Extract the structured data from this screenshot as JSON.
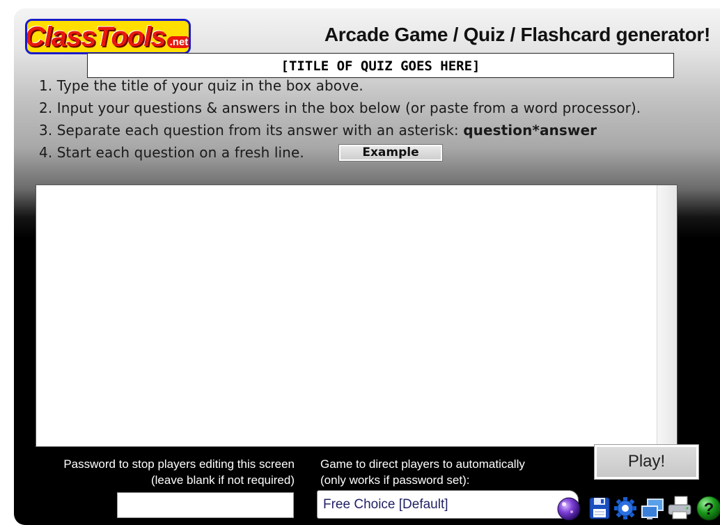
{
  "header": {
    "logo_text": "ClassTools",
    "logo_suffix": ".net",
    "title": "Arcade Game / Quiz / Flashcard generator!"
  },
  "quiz_title": {
    "value": "[TITLE OF QUIZ GOES HERE]"
  },
  "instructions": {
    "step1": "1. Type the title of your quiz in the box above.",
    "step2": "2. Input your questions & answers in the box below (or paste from a word processor).",
    "step3_text": "3. Separate each question from its answer with an asterisk: ",
    "step3_bold": "question*answer",
    "step4": "4. Start each question on a fresh line.",
    "example_button": "Example"
  },
  "editor": {
    "content": ""
  },
  "footer": {
    "password_label_line1": "Password to stop players editing this screen",
    "password_label_line2": "(leave blank if not required)",
    "password_value": "",
    "game_label_line1": "Game to direct players to automatically",
    "game_label_line2": "(only works if password set):",
    "game_selected": "Free Choice [Default]",
    "play_button": "Play!"
  },
  "icons": [
    "crystal-ball-icon",
    "save-icon",
    "settings-icon",
    "screens-icon",
    "print-icon",
    "help-icon"
  ],
  "colors": {
    "logo_red": "#e8180c",
    "logo_yellow": "#ffde00",
    "logo_border": "#1a1acc",
    "help_green": "#1a9a1a",
    "save_blue": "#1a4fc0"
  }
}
